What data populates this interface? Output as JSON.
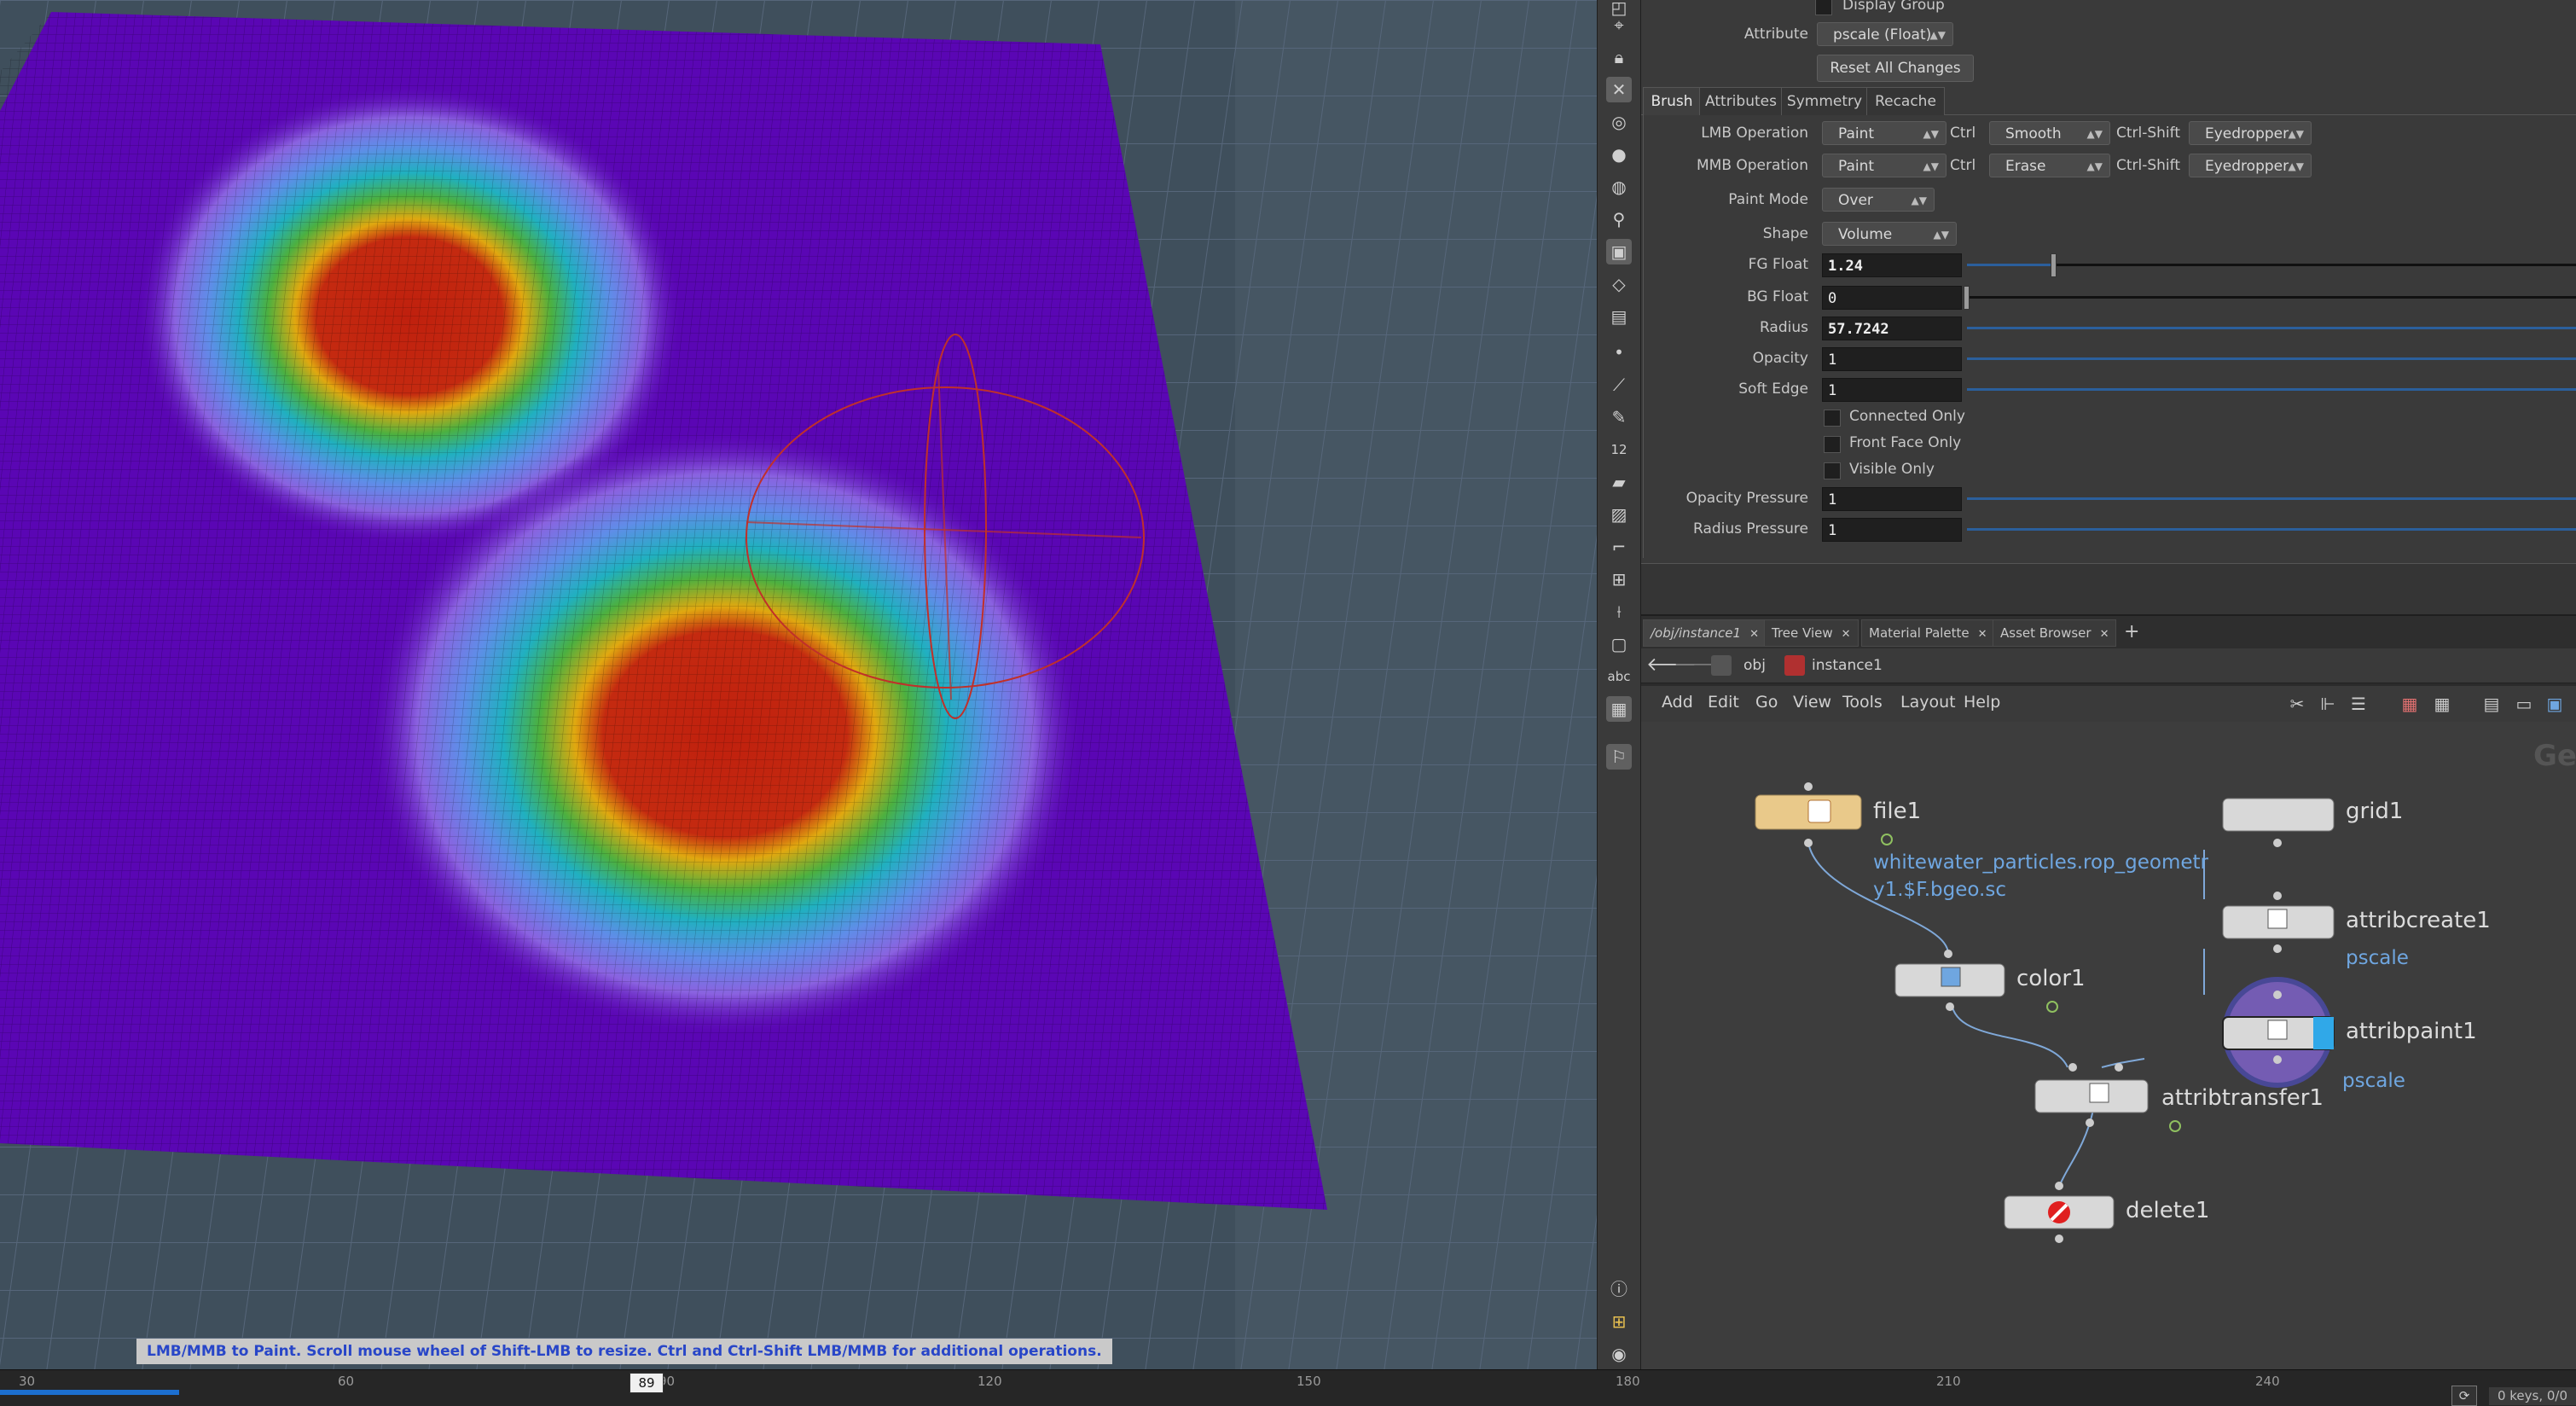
{
  "viewport": {
    "status_message": "LMB/MMB to Paint.  Scroll mouse wheel of Shift-LMB to resize.  Ctrl and Ctrl-Shift LMB/MMB for additional operations."
  },
  "timeline": {
    "ticks": [
      "30",
      "60",
      "90",
      "120",
      "150",
      "180",
      "210",
      "240"
    ],
    "current_frame": "89",
    "keys_status": "0 keys, 0/0"
  },
  "shelf": {
    "icons": [
      "select-icon",
      "view-icon",
      "lock-icon",
      "handle-icon",
      "snap-icon",
      "light-icon",
      "light-add-icon",
      "pin-icon",
      "camera-icon",
      "wire-icon",
      "render-icon",
      "point-icon",
      "brush-icon",
      "pen-icon",
      "number-icon",
      "paint-icon",
      "stamp-icon",
      "curve-icon",
      "grid-icon",
      "edit-icon",
      "box-icon",
      "text-icon",
      "image-icon",
      "marker-icon",
      "info-icon",
      "layout-icon",
      "eye-icon"
    ]
  },
  "params": {
    "display_group_label": "Display Group",
    "attribute_label": "Attribute",
    "attribute_value": "pscale (Float)",
    "reset_button": "Reset All Changes",
    "tabs": [
      "Brush",
      "Attributes",
      "Symmetry",
      "Recache"
    ],
    "lmb_label": "LMB Operation",
    "lmb_value": "Paint",
    "ctrl_label": "Ctrl",
    "lmb_ctrl_value": "Smooth",
    "ctrl_shift_label": "Ctrl-Shift",
    "lmb_ctrl_shift_value": "Eyedropper",
    "mmb_label": "MMB Operation",
    "mmb_value": "Paint",
    "mmb_ctrl_value": "Erase",
    "mmb_ctrl_shift_value": "Eyedropper",
    "paint_mode_label": "Paint Mode",
    "paint_mode_value": "Over",
    "shape_label": "Shape",
    "shape_value": "Volume",
    "fg_float_label": "FG Float",
    "fg_float_value": "1.24",
    "bg_float_label": "BG Float",
    "bg_float_value": "0",
    "radius_label": "Radius",
    "radius_value": "57.7242",
    "opacity_label": "Opacity",
    "opacity_value": "1",
    "soft_edge_label": "Soft Edge",
    "soft_edge_value": "1",
    "connected_only": "Connected Only",
    "front_face_only": "Front Face Only",
    "visible_only": "Visible Only",
    "opacity_pressure_label": "Opacity Pressure",
    "opacity_pressure_value": "1",
    "radius_pressure_label": "Radius Pressure",
    "radius_pressure_value": "1"
  },
  "network": {
    "tabs": [
      "/obj/instance1",
      "Tree View",
      "Material Palette",
      "Asset Browser"
    ],
    "add_tab": "+",
    "path_obj": "obj",
    "path_node": "instance1",
    "menu": [
      "Add",
      "Edit",
      "Go",
      "View",
      "Tools",
      "Layout",
      "Help"
    ],
    "watermark": "Ge",
    "nodes": {
      "file1": "file1",
      "file1_sub_1": "whitewater_particles.rop_geometr",
      "file1_sub_2": "y1.$F.bgeo.sc",
      "grid1": "grid1",
      "attribcreate1": "attribcreate1",
      "attribcreate1_sub": "pscale",
      "color1": "color1",
      "attribpaint1": "attribpaint1",
      "attribpaint1_sub": "pscale",
      "attribtransfer1": "attribtransfer1",
      "delete1": "delete1"
    }
  },
  "colors": {
    "heat_hot": "#c0200e",
    "heat_cold": "#5a06b4",
    "brush": "#c0302a",
    "file_node": "#e9c98a",
    "attribpaint_ring": "#7a60c0",
    "status_text": "#2846c8"
  }
}
